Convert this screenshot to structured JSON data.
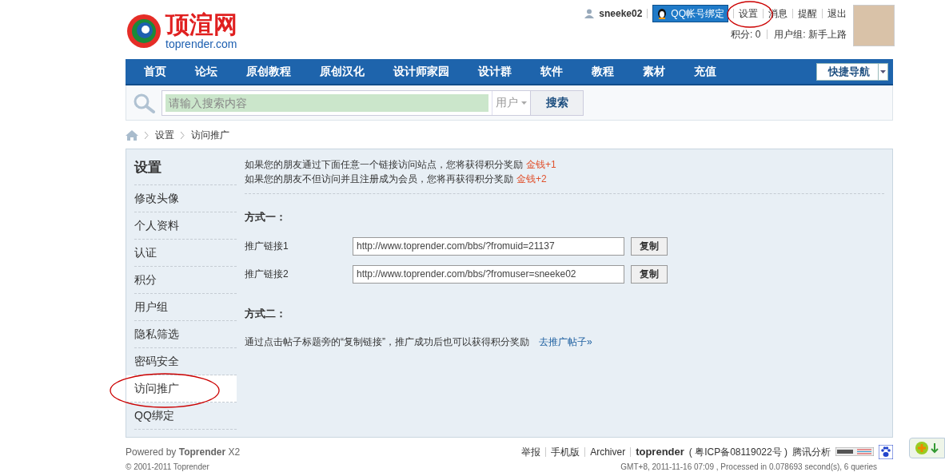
{
  "header": {
    "logo_title": "顶渲网",
    "logo_domain": "toprender.com",
    "username": "sneeke02",
    "qq_bind": "QQ帐号绑定",
    "links": [
      "设置",
      "消息",
      "提醒",
      "退出"
    ],
    "credits": "积分: 0",
    "usergroup": "用户组: 新手上路"
  },
  "nav": {
    "items": [
      "首页",
      "论坛",
      "原创教程",
      "原创汉化",
      "设计师家园",
      "设计群",
      "软件",
      "教程",
      "素材",
      "充值"
    ],
    "quick_nav": "快捷导航"
  },
  "search": {
    "placeholder": "请输入搜索内容",
    "scope": "用户",
    "button": "搜索"
  },
  "breadcrumb": [
    "设置",
    "访问推广"
  ],
  "sidebar": {
    "title": "设置",
    "items": [
      {
        "label": "修改头像",
        "selected": false
      },
      {
        "label": "个人资料",
        "selected": false
      },
      {
        "label": "认证",
        "selected": false
      },
      {
        "label": "积分",
        "selected": false
      },
      {
        "label": "用户组",
        "selected": false
      },
      {
        "label": "隐私筛选",
        "selected": false
      },
      {
        "label": "密码安全",
        "selected": false
      },
      {
        "label": "访问推广",
        "selected": true
      },
      {
        "label": "QQ绑定",
        "selected": false
      }
    ]
  },
  "main": {
    "intro": [
      {
        "text": "如果您的朋友通过下面任意一个链接访问站点，您将获得积分奖励",
        "reward": "金钱+1"
      },
      {
        "text": "如果您的朋友不但访问并且注册成为会员，您将再获得积分奖励",
        "reward": "金钱+2"
      }
    ],
    "method1": "方式一：",
    "links": [
      {
        "label": "推广链接1",
        "value": "http://www.toprender.com/bbs/?fromuid=21137",
        "button": "复制"
      },
      {
        "label": "推广链接2",
        "value": "http://www.toprender.com/bbs/?fromuser=sneeke02",
        "button": "复制"
      }
    ],
    "method2": "方式二：",
    "description": "通过点击帖子标题旁的“复制链接”，推广成功后也可以获得积分奖励",
    "description_link": "去推广帖子»"
  },
  "footer": {
    "powered": "Powered by **Toprender** X2",
    "links": [
      "举报",
      "手机版",
      "Archiver"
    ],
    "site": "toprender",
    "icp": "( 粤ICP备08119022号 )",
    "analytics": "腾讯分析",
    "copyright": "© 2001-2011 Toprender",
    "processed": "GMT+8, 2011-11-16 07:09 , Processed in 0.078693 second(s), 6 queries"
  }
}
